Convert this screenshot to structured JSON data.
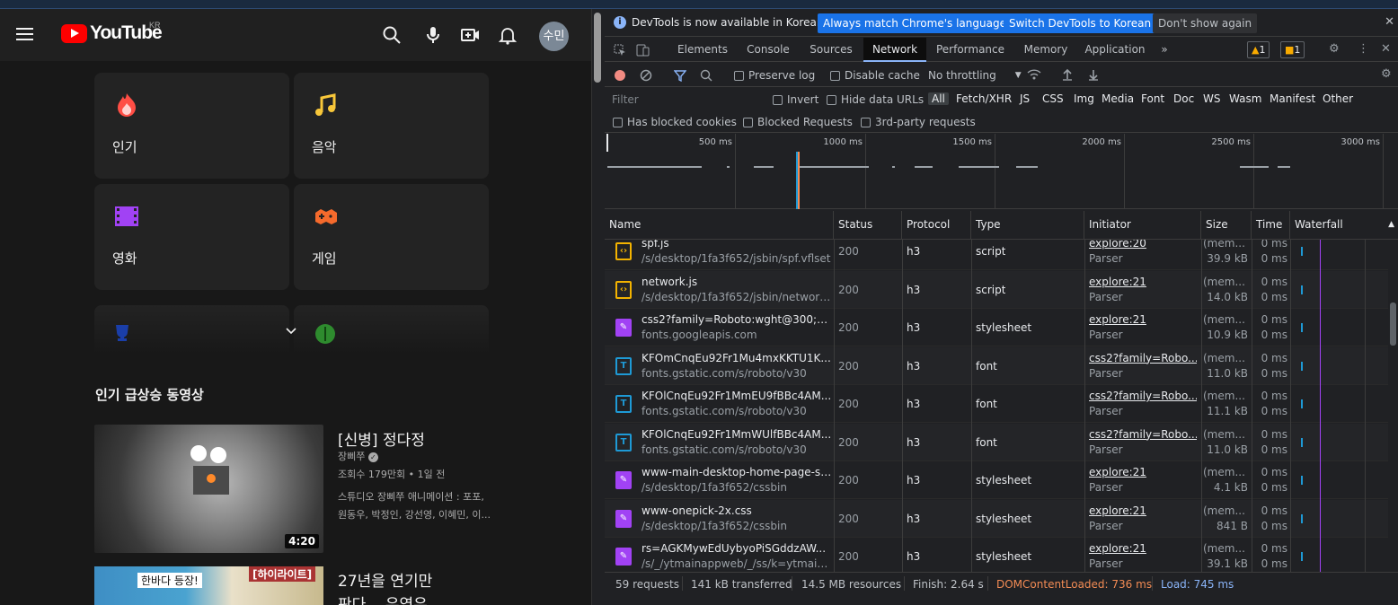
{
  "youtube": {
    "logo_text": "YouTube",
    "region": "KR",
    "avatar_text": "수민",
    "categories": [
      {
        "label": "인기",
        "icon": "trending-flame-icon"
      },
      {
        "label": "음악",
        "icon": "music-note-icon"
      },
      {
        "label": "영화",
        "icon": "film-icon"
      },
      {
        "label": "게임",
        "icon": "gamepad-icon"
      }
    ],
    "section_title": "인기 급상승 동영상",
    "videos": [
      {
        "title": "[신병] 정다정",
        "channel": "장삐쭈",
        "stats": "조회수 179만회 • 1일 전",
        "description": "스튜디오 장삐쭈 애니메이션 : 포포, 원동우, 박정인, 강선영, 이혜민, 이...",
        "duration": "4:20"
      },
      {
        "title": "27년을 연기만",
        "title_line2": "판다... 우영우",
        "thumb_text1": "한바다 등장!",
        "thumb_text2": "[하이라이트]"
      }
    ]
  },
  "devtools": {
    "infobar": {
      "text": "DevTools is now available in Korean!",
      "btn_match": "Always match Chrome's language",
      "btn_switch": "Switch DevTools to Korean",
      "btn_dismiss": "Don't show again"
    },
    "tabs": [
      "Elements",
      "Console",
      "Sources",
      "Network",
      "Performance",
      "Memory",
      "Application"
    ],
    "active_tab": "Network",
    "warnings": "1",
    "issues": "1",
    "toolbar": {
      "preserve_log": "Preserve log",
      "disable_cache": "Disable cache",
      "throttling": "No throttling"
    },
    "filter": {
      "placeholder": "Filter",
      "invert": "Invert",
      "hide_data_urls": "Hide data URLs",
      "types": [
        "All",
        "Fetch/XHR",
        "JS",
        "CSS",
        "Img",
        "Media",
        "Font",
        "Doc",
        "WS",
        "Wasm",
        "Manifest",
        "Other"
      ],
      "has_blocked_cookies": "Has blocked cookies",
      "blocked_requests": "Blocked Requests",
      "third_party": "3rd-party requests"
    },
    "overview_ticks": [
      "500 ms",
      "1000 ms",
      "1500 ms",
      "2000 ms",
      "2500 ms",
      "3000 ms"
    ],
    "columns": [
      "Name",
      "Status",
      "Protocol",
      "Type",
      "Initiator",
      "Size",
      "Time",
      "Waterfall"
    ],
    "requests": [
      {
        "name": "spf.js",
        "path": "/s/desktop/1fa3f652/jsbin/spf.vflset",
        "status": "200",
        "protocol": "h3",
        "type": "script",
        "initiator": "explore:20",
        "initiator_type": "Parser",
        "size": "(mem...",
        "size2": "39.9 kB",
        "time": "0 ms",
        "time2": "0 ms",
        "kind": "script"
      },
      {
        "name": "network.js",
        "path": "/s/desktop/1fa3f652/jsbin/network....",
        "status": "200",
        "protocol": "h3",
        "type": "script",
        "initiator": "explore:21",
        "initiator_type": "Parser",
        "size": "(mem...",
        "size2": "14.0 kB",
        "time": "0 ms",
        "time2": "0 ms",
        "kind": "script"
      },
      {
        "name": "css2?family=Roboto:wght@300;40...",
        "path": "fonts.googleapis.com",
        "status": "200",
        "protocol": "h3",
        "type": "stylesheet",
        "initiator": "explore:21",
        "initiator_type": "Parser",
        "size": "(mem...",
        "size2": "10.9 kB",
        "time": "0 ms",
        "time2": "0 ms",
        "kind": "style"
      },
      {
        "name": "KFOmCnqEu92Fr1Mu4mxKKTU1K...",
        "path": "fonts.gstatic.com/s/roboto/v30",
        "status": "200",
        "protocol": "h3",
        "type": "font",
        "initiator": "css2?family=Robo...",
        "initiator_type": "Parser",
        "size": "(mem...",
        "size2": "11.0 kB",
        "time": "0 ms",
        "time2": "0 ms",
        "kind": "font"
      },
      {
        "name": "KFOlCnqEu92Fr1MmEU9fBBc4AM...",
        "path": "fonts.gstatic.com/s/roboto/v30",
        "status": "200",
        "protocol": "h3",
        "type": "font",
        "initiator": "css2?family=Robo...",
        "initiator_type": "Parser",
        "size": "(mem...",
        "size2": "11.1 kB",
        "time": "0 ms",
        "time2": "0 ms",
        "kind": "font"
      },
      {
        "name": "KFOlCnqEu92Fr1MmWUlfBBc4AM...",
        "path": "fonts.gstatic.com/s/roboto/v30",
        "status": "200",
        "protocol": "h3",
        "type": "font",
        "initiator": "css2?family=Robo...",
        "initiator_type": "Parser",
        "size": "(mem...",
        "size2": "11.0 kB",
        "time": "0 ms",
        "time2": "0 ms",
        "kind": "font"
      },
      {
        "name": "www-main-desktop-home-page-sk...",
        "path": "/s/desktop/1fa3f652/cssbin",
        "status": "200",
        "protocol": "h3",
        "type": "stylesheet",
        "initiator": "explore:21",
        "initiator_type": "Parser",
        "size": "(mem...",
        "size2": "4.1 kB",
        "time": "0 ms",
        "time2": "0 ms",
        "kind": "style"
      },
      {
        "name": "www-onepick-2x.css",
        "path": "/s/desktop/1fa3f652/cssbin",
        "status": "200",
        "protocol": "h3",
        "type": "stylesheet",
        "initiator": "explore:21",
        "initiator_type": "Parser",
        "size": "(mem...",
        "size2": "841 B",
        "time": "0 ms",
        "time2": "0 ms",
        "kind": "style"
      },
      {
        "name": "rs=AGKMywEdUybyoPiSGddzAW...",
        "path": "/s/_/ytmainappweb/_/ss/k=ytmaina...",
        "status": "200",
        "protocol": "h3",
        "type": "stylesheet",
        "initiator": "explore:21",
        "initiator_type": "Parser",
        "size": "(mem...",
        "size2": "39.1 kB",
        "time": "0 ms",
        "time2": "0 ms",
        "kind": "style"
      }
    ],
    "status": {
      "requests": "59 requests",
      "transferred": "141 kB transferred",
      "resources": "14.5 MB resources",
      "finish": "Finish: 2.64 s",
      "dom_loaded": "DOMContentLoaded: 736 ms",
      "load": "Load: 745 ms"
    },
    "colors": {
      "dom_loaded": "#f28b54",
      "load": "#8ab4f8",
      "accent": "#1a73e8"
    }
  }
}
